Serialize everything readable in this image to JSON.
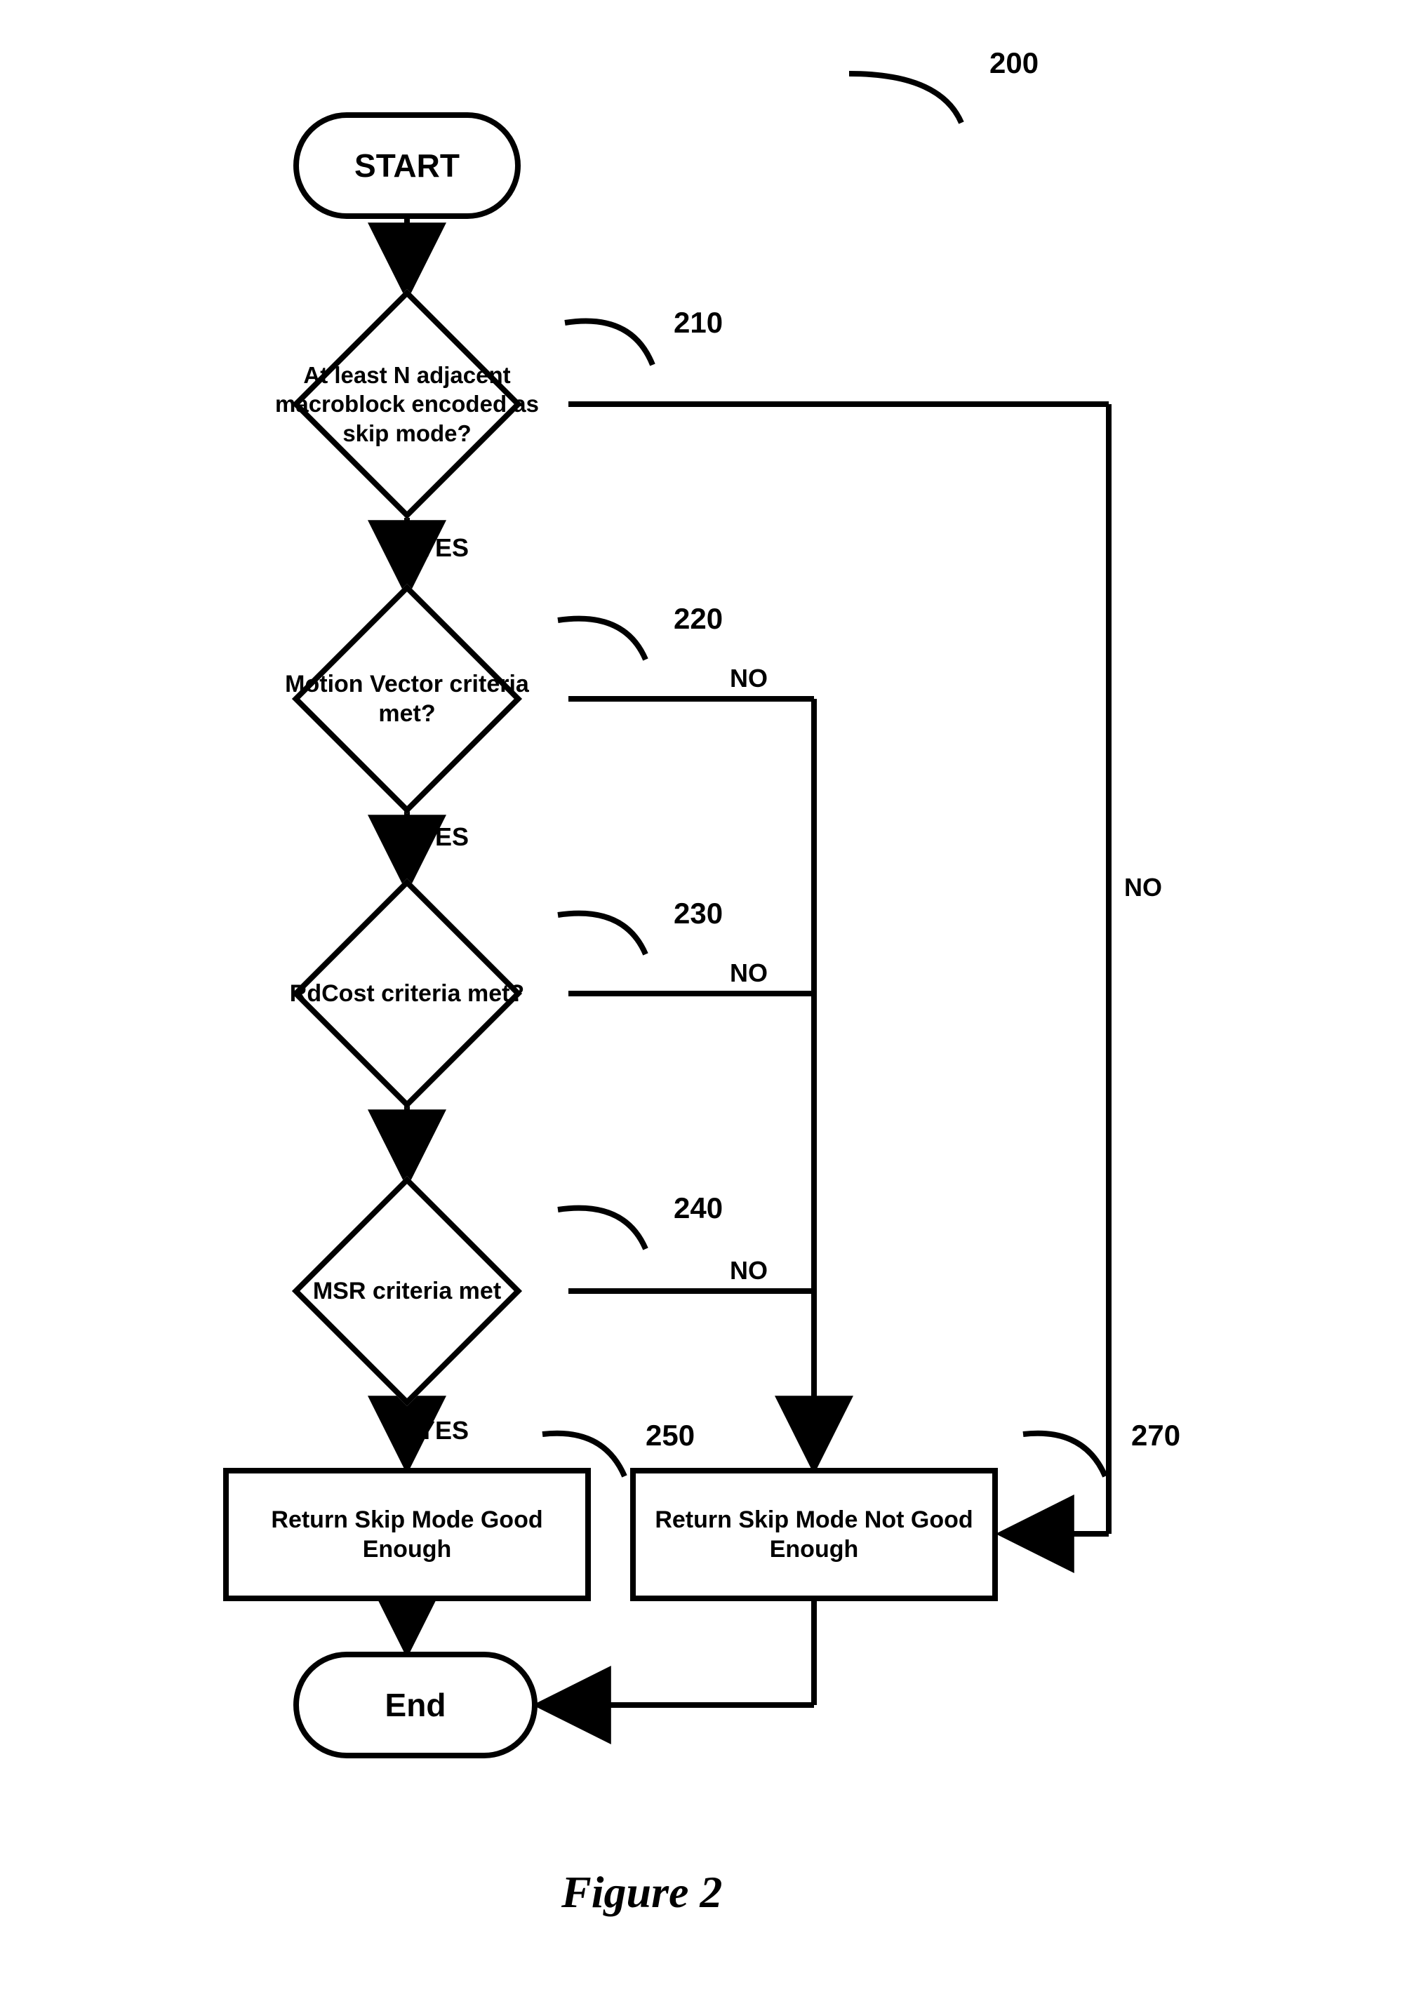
{
  "refs": {
    "r200": "200",
    "r210": "210",
    "r220": "220",
    "r230": "230",
    "r240": "240",
    "r250": "250",
    "r270": "270"
  },
  "nodes": {
    "start": "START",
    "d210": "At least N adjacent macroblock encoded as skip mode?",
    "d220": "Motion Vector criteria met?",
    "d230": "RdCost criteria met?",
    "d240": "MSR criteria met",
    "p250": "Return Skip Mode Good Enough",
    "p270": "Return Skip Mode Not Good Enough",
    "end": "End"
  },
  "edges": {
    "yes210": "YES",
    "yes220": "YES",
    "yes240": "YES",
    "no210": "NO",
    "no220": "NO",
    "no230": "NO",
    "no240": "NO"
  },
  "figure": "Figure 2",
  "chart_data": {
    "type": "flowchart",
    "title": "Figure 2",
    "id": "200",
    "nodes": [
      {
        "id": "start",
        "type": "terminal",
        "label": "START"
      },
      {
        "id": "210",
        "type": "decision",
        "label": "At least N adjacent macroblock encoded as skip mode?"
      },
      {
        "id": "220",
        "type": "decision",
        "label": "Motion Vector criteria met?"
      },
      {
        "id": "230",
        "type": "decision",
        "label": "RdCost criteria met?"
      },
      {
        "id": "240",
        "type": "decision",
        "label": "MSR criteria met"
      },
      {
        "id": "250",
        "type": "process",
        "label": "Return Skip Mode Good Enough"
      },
      {
        "id": "270",
        "type": "process",
        "label": "Return Skip Mode Not Good Enough"
      },
      {
        "id": "end",
        "type": "terminal",
        "label": "End"
      }
    ],
    "edges": [
      {
        "from": "start",
        "to": "210",
        "label": ""
      },
      {
        "from": "210",
        "to": "220",
        "label": "YES"
      },
      {
        "from": "210",
        "to": "270",
        "label": "NO"
      },
      {
        "from": "220",
        "to": "230",
        "label": "YES"
      },
      {
        "from": "220",
        "to": "270",
        "label": "NO"
      },
      {
        "from": "230",
        "to": "240",
        "label": ""
      },
      {
        "from": "230",
        "to": "270",
        "label": "NO"
      },
      {
        "from": "240",
        "to": "250",
        "label": "YES"
      },
      {
        "from": "240",
        "to": "270",
        "label": "NO"
      },
      {
        "from": "250",
        "to": "end",
        "label": ""
      },
      {
        "from": "270",
        "to": "end",
        "label": ""
      }
    ]
  }
}
